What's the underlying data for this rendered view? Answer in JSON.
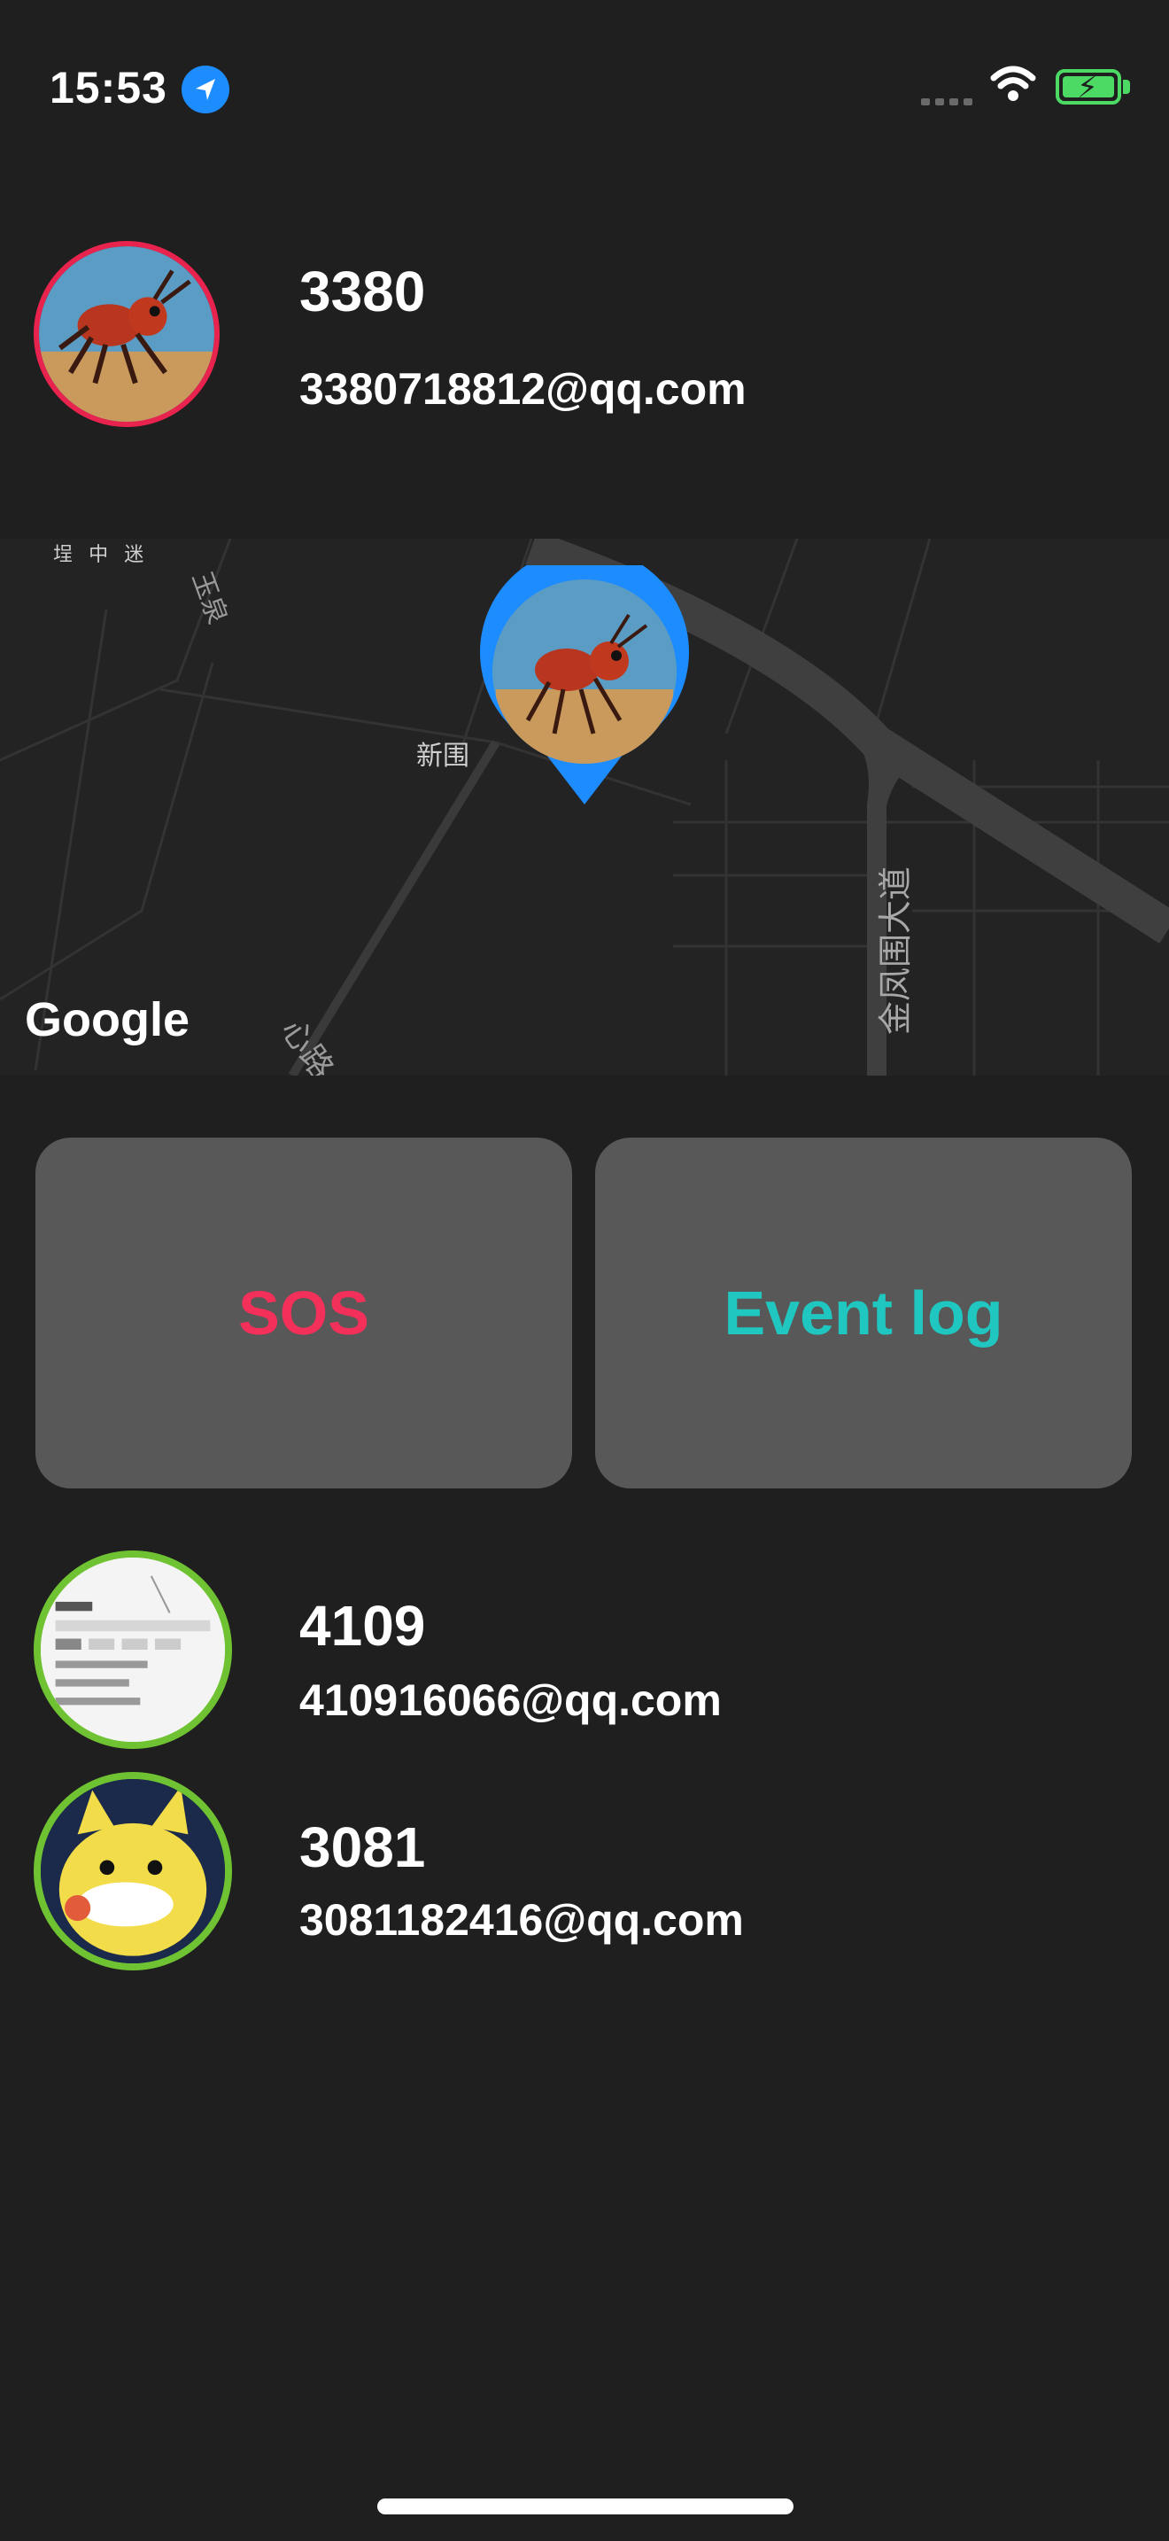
{
  "status_bar": {
    "time": "15:53",
    "icons": [
      "location-arrow-icon",
      "cellular-signal-icon",
      "wifi-icon",
      "battery-charging-icon"
    ],
    "battery_color": "#4cd964"
  },
  "current_user": {
    "name": "3380",
    "email": "3380718812@qq.com",
    "avatar": "ant-avatar",
    "ring_color": "#e8234e"
  },
  "map": {
    "provider": "Google",
    "labels": {
      "top_left": "埕 中 迷",
      "road_top": "玉泉",
      "xin_wei": "新围",
      "jinfengwei": "金凤围大道",
      "road_bottom": "心路"
    },
    "marker": "ant-avatar",
    "marker_color": "#1d8cff"
  },
  "actions": {
    "sos_label": "SOS",
    "event_log_label": "Event log",
    "sos_color": "#f2305a",
    "event_log_color": "#1fc7c0"
  },
  "contacts": [
    {
      "name": "4109",
      "email": "410916066@qq.com",
      "avatar": "screenshot-avatar",
      "ring_color": "#6fc232"
    },
    {
      "name": "3081",
      "email": "3081182416@qq.com",
      "avatar": "cartoon-avatar",
      "ring_color": "#6fc232"
    }
  ]
}
